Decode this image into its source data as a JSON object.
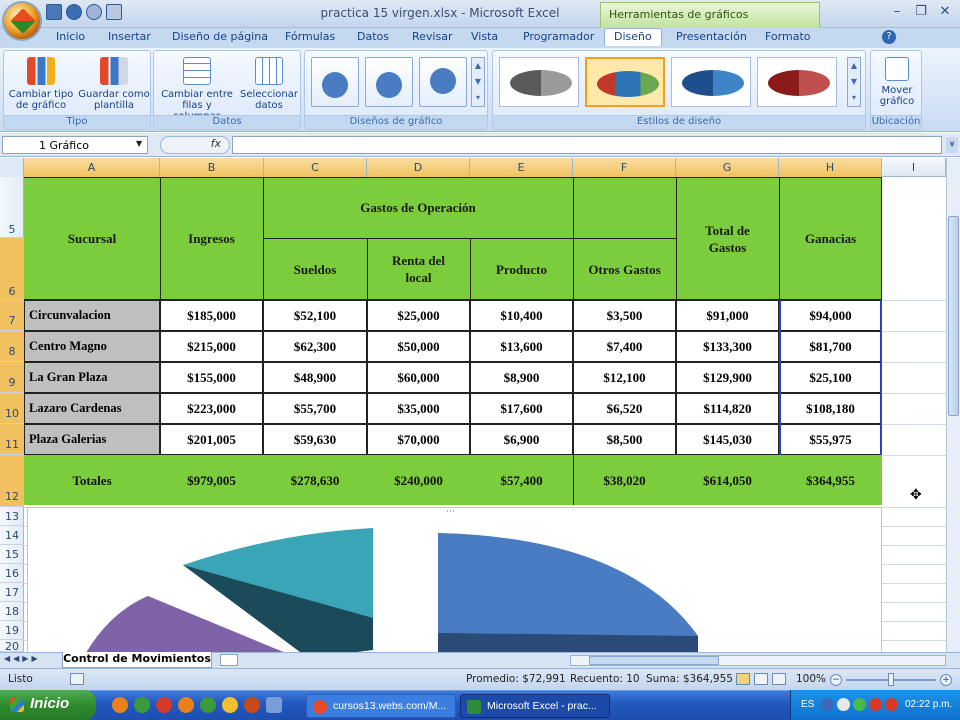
{
  "window": {
    "title": "practica 15 virgen.xlsx - Microsoft Excel",
    "context_tab": "Herramientas de gráficos",
    "min": "–",
    "restore": "❐",
    "close": "✕"
  },
  "ribbon_tabs": [
    "Inicio",
    "Insertar",
    "Diseño de página",
    "Fórmulas",
    "Datos",
    "Revisar",
    "Vista",
    "Programador",
    "Diseño",
    "Presentación",
    "Formato"
  ],
  "ribbon": {
    "tipo": {
      "title": "Tipo",
      "change_type": "Cambiar tipo de gráfico",
      "save_template": "Guardar como plantilla"
    },
    "datos": {
      "title": "Datos",
      "switch": "Cambiar entre filas y columnas",
      "select": "Seleccionar datos"
    },
    "disenos": {
      "title": "Diseños de gráfico"
    },
    "estilos": {
      "title": "Estilos de diseño"
    },
    "ubicacion": {
      "title": "Ubicación",
      "move": "Mover gráfico"
    }
  },
  "formula_bar": {
    "name_box": "1 Gráfico",
    "fx": "fx",
    "value": ""
  },
  "columns": [
    "A",
    "B",
    "C",
    "D",
    "E",
    "F",
    "G",
    "H",
    "I"
  ],
  "rows": [
    "5",
    "6",
    "7",
    "8",
    "9",
    "10",
    "11",
    "12",
    "13",
    "14",
    "15",
    "16",
    "17",
    "18",
    "19",
    "20"
  ],
  "table": {
    "headers": {
      "sucursal": "Sucursal",
      "ingresos": "Ingresos",
      "gastos_op": "Gastos de Operación",
      "sueldos": "Sueldos",
      "renta": "Renta del local",
      "producto": "Producto",
      "otros": "Otros Gastos",
      "total": "Total de Gastos",
      "ganancias": "Ganacias"
    },
    "rows": [
      [
        "Circunvalacion",
        "$185,000",
        "$52,100",
        "$25,000",
        "$10,400",
        "$3,500",
        "$91,000",
        "$94,000"
      ],
      [
        "Centro Magno",
        "$215,000",
        "$62,300",
        "$50,000",
        "$13,600",
        "$7,400",
        "$133,300",
        "$81,700"
      ],
      [
        "La Gran Plaza",
        "$155,000",
        "$48,900",
        "$60,000",
        "$8,900",
        "$12,100",
        "$129,900",
        "$25,100"
      ],
      [
        "Lazaro Cardenas",
        "$223,000",
        "$55,700",
        "$35,000",
        "$17,600",
        "$6,520",
        "$114,820",
        "$108,180"
      ],
      [
        "Plaza Galerias",
        "$201,005",
        "$59,630",
        "$70,000",
        "$6,900",
        "$8,500",
        "$145,030",
        "$55,975"
      ]
    ],
    "totals": [
      "Totales",
      "$979,005",
      "$278,630",
      "$240,000",
      "$57,400",
      "$38,020",
      "$614,050",
      "$364,955"
    ]
  },
  "sheet_tab": "Control de Movimientos",
  "status": {
    "ready": "Listo",
    "average": "Promedio: $72,991",
    "count": "Recuento: 10",
    "sum": "Suma: $364,955",
    "zoom": "100%"
  },
  "taskbar": {
    "start": "Inicio",
    "tasks": [
      "cursos13.webs.com/M...",
      "Microsoft Excel - prac..."
    ],
    "lang": "ES",
    "clock": "02:22 p.m."
  },
  "colors": {
    "header_green": "#7ccd3c",
    "name_gray": "#bfbfbf"
  }
}
